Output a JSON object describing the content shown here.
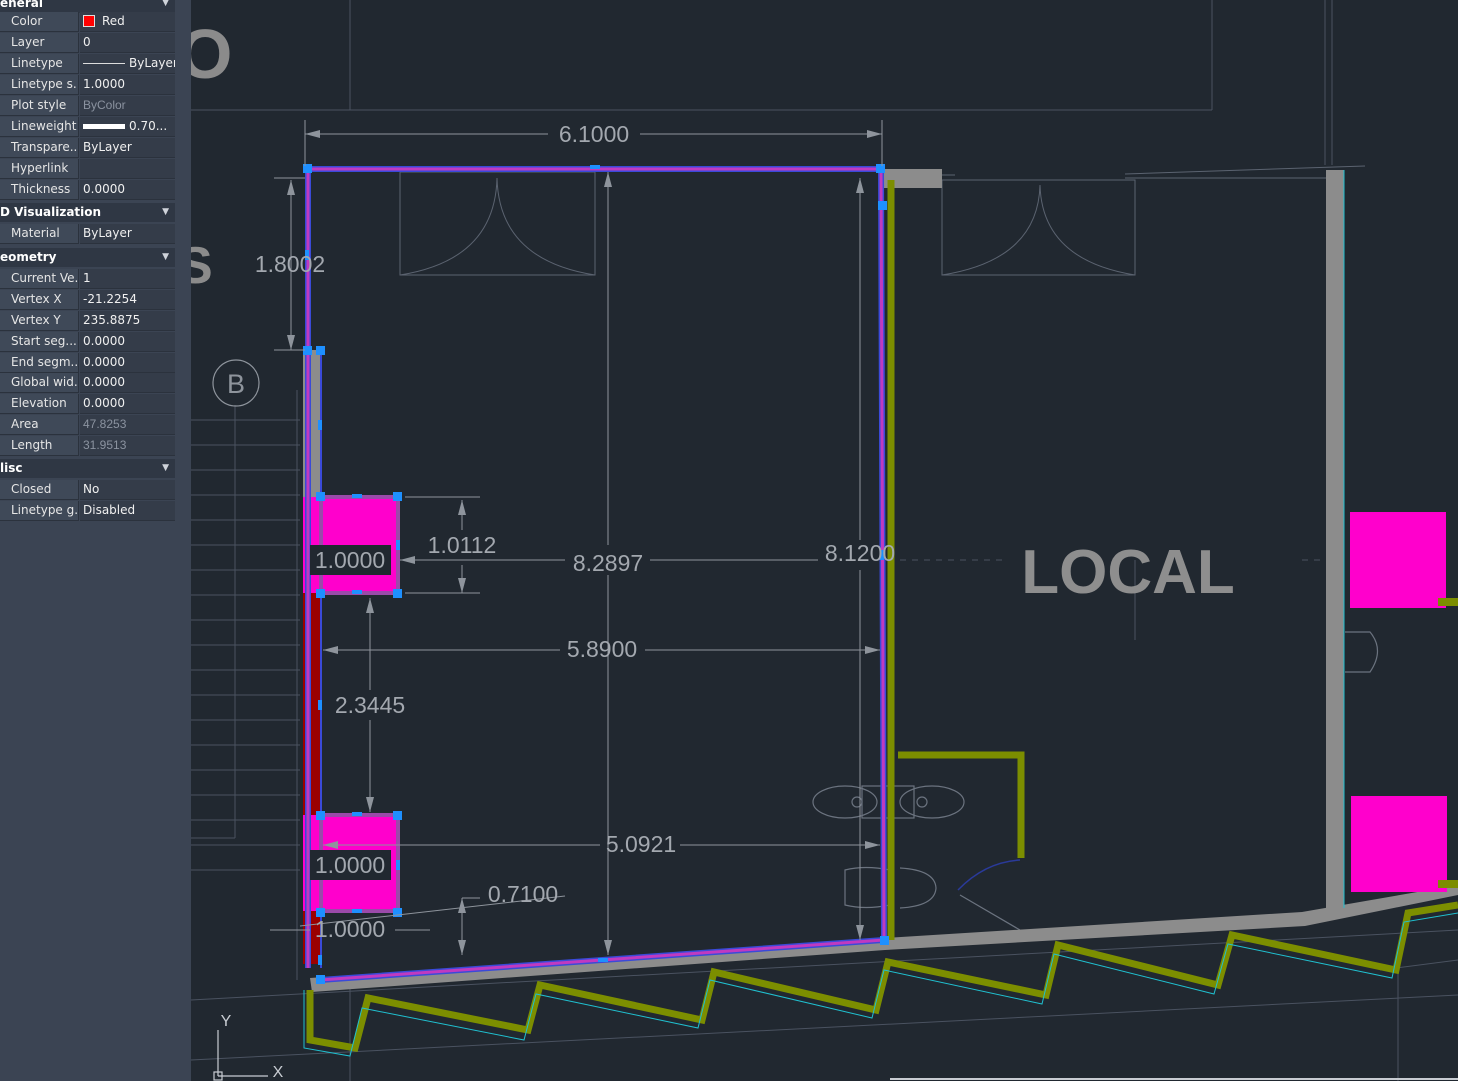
{
  "properties": {
    "general": {
      "title": "eneral",
      "rows": [
        {
          "key": "Color",
          "value": "Red"
        },
        {
          "key": "Layer",
          "value": "0"
        },
        {
          "key": "Linetype",
          "value": "ByLayer"
        },
        {
          "key": "Linetype s...",
          "value": "1.0000"
        },
        {
          "key": "Plot style",
          "value": "ByColor"
        },
        {
          "key": "Lineweight",
          "value": "0.70..."
        },
        {
          "key": "Transpare...",
          "value": "ByLayer"
        },
        {
          "key": "Hyperlink",
          "value": ""
        },
        {
          "key": "Thickness",
          "value": "0.0000"
        }
      ]
    },
    "visualization": {
      "title": "D Visualization",
      "rows": [
        {
          "key": "Material",
          "value": "ByLayer"
        }
      ]
    },
    "geometry": {
      "title": "eometry",
      "rows": [
        {
          "key": "Current Ve...",
          "value": "1"
        },
        {
          "key": "Vertex X",
          "value": "-21.2254"
        },
        {
          "key": "Vertex Y",
          "value": "235.8875"
        },
        {
          "key": "Start seg...",
          "value": "0.0000"
        },
        {
          "key": "End segm...",
          "value": "0.0000"
        },
        {
          "key": "Global wid...",
          "value": "0.0000"
        },
        {
          "key": "Elevation",
          "value": "0.0000"
        },
        {
          "key": "Area",
          "value": "47.8253"
        },
        {
          "key": "Length",
          "value": "31.9513"
        }
      ]
    },
    "misc": {
      "title": "lisc",
      "rows": [
        {
          "key": "Closed",
          "value": "No"
        },
        {
          "key": "Linetype g...",
          "value": "Disabled"
        }
      ]
    }
  },
  "drawing": {
    "dimensions": {
      "d1": "6.1000",
      "d2": "1.8002",
      "d3": "1.0112",
      "d4": "8.2897",
      "d5": "8.1200",
      "d6": "1.0000",
      "d7": "5.8900",
      "d8": "2.3445",
      "d9": "1.0000",
      "d10": "5.0921",
      "d11": "0.7100",
      "d12": "1.0000"
    },
    "labels": {
      "room": "LOCAL",
      "grid_bubble": "B",
      "partial_top": "O",
      "partial_mid": "S"
    },
    "ucs": {
      "x": "X",
      "y": "Y"
    }
  },
  "colors": {
    "background": "#212830",
    "selection": "#1e90ff",
    "magenta": "#ff00cc",
    "wall": "#8a8a8a",
    "olive": "#8a9a00",
    "red": "#9b0000"
  }
}
